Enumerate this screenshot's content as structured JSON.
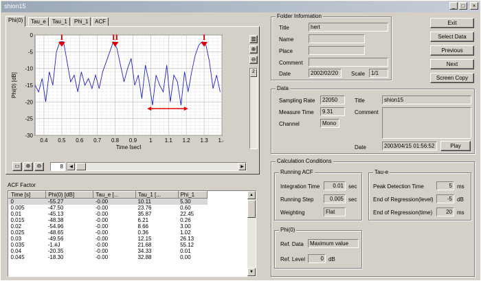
{
  "window": {
    "title": "shion15"
  },
  "tabs": [
    "Phi(0)",
    "Tau_e",
    "Tau_1",
    "Phi_1",
    "ACF"
  ],
  "chart_data": {
    "type": "line",
    "xlabel": "Time [sec]",
    "ylabel": "Phi(0) [dB]",
    "xlim": [
      0.35,
      1.4
    ],
    "ylim": [
      -30,
      0
    ],
    "xticks": [
      "0.4",
      "0.5",
      "0.6",
      "0.7",
      "0.8",
      "0.9",
      "1",
      "1.1",
      "1.2",
      "1.3",
      "1.4"
    ],
    "yticks": [
      "0",
      "-5",
      "-10",
      "-15",
      "-20",
      "-25",
      "-30"
    ],
    "grid": true,
    "series": [
      {
        "x": [
          0.35,
          0.37,
          0.39,
          0.41,
          0.43,
          0.45,
          0.47,
          0.49,
          0.51,
          0.53,
          0.55,
          0.57,
          0.59,
          0.61,
          0.63,
          0.65,
          0.67,
          0.69,
          0.71,
          0.73,
          0.75,
          0.77,
          0.79,
          0.81,
          0.83,
          0.85,
          0.87,
          0.89,
          0.91,
          0.93,
          0.95,
          0.97,
          0.99,
          1.01,
          1.03,
          1.05,
          1.07,
          1.09,
          1.11,
          1.13,
          1.15,
          1.17,
          1.19,
          1.21,
          1.23,
          1.25,
          1.27,
          1.29,
          1.31,
          1.33,
          1.35,
          1.37,
          1.39
        ],
        "y": [
          -15,
          -17,
          -13,
          -20,
          -11,
          -15,
          -5,
          -2,
          -2,
          -8,
          -14,
          -12,
          -17,
          -11,
          -15,
          -13,
          -16,
          -12,
          -16,
          -11,
          -8,
          -5,
          -2,
          -4,
          -9,
          -14,
          -10,
          -7,
          -15,
          -12,
          -19,
          -9,
          -14,
          -21,
          -12,
          -15,
          -17,
          -9,
          -20,
          -12,
          -14,
          -21,
          -11,
          -17,
          -11,
          -6,
          -3,
          -2,
          -3,
          -8,
          -16,
          -12,
          -17
        ]
      }
    ],
    "annotations": [
      {
        "text": "I",
        "x": 0.5
      },
      {
        "text": "II",
        "x": 0.8
      },
      {
        "text": "I",
        "x": 1.3
      }
    ]
  },
  "chart_toolbar": {
    "value": "8"
  },
  "acf": {
    "title": "ACF Factor",
    "columns": [
      "Time [s]",
      "Phi(0) [dB]",
      "Tau_e [...",
      "Tau_1 [...",
      "Phi_1"
    ],
    "rows": [
      [
        "0",
        "-55.27",
        "-0.00",
        "10.11",
        "5.30"
      ],
      [
        "0.005",
        "-47.50",
        "-0.00",
        "23.76",
        "0.60"
      ],
      [
        "0.01",
        "-45.13",
        "-0.00",
        "35.87",
        "22.45"
      ],
      [
        "0.015",
        "-48.38",
        "-0.00",
        "6.21",
        "0.26"
      ],
      [
        "0.02",
        "-54.96",
        "-0.00",
        "8.66",
        "3.00"
      ],
      [
        "0.025",
        "-48.65",
        "-0.00",
        "0.36",
        "1.02"
      ],
      [
        "0.03",
        "-49.56",
        "-0.00",
        "12.15",
        "26.13"
      ],
      [
        "0.035",
        "-1.#J",
        "-0.00",
        "21.68",
        "55.12"
      ],
      [
        "0.04",
        "-20.35",
        "-0.00",
        "34.33",
        "0.01"
      ],
      [
        "0.045",
        "-18.30",
        "-0.00",
        "32.88",
        "0.00"
      ]
    ]
  },
  "folder": {
    "title": "Folder Information",
    "title_label": "Title",
    "title_value": "hert",
    "name_label": "Name",
    "name_value": "",
    "place_label": "Place",
    "place_value": "",
    "comment_label": "Comment",
    "comment_value": "",
    "date_label": "Date",
    "date_value": "2002/02/20",
    "scale_label": "Scale",
    "scale_value": "1/1"
  },
  "buttons": {
    "exit": "Exit",
    "select_data": "Select Data",
    "previous": "Previous",
    "next": "Next",
    "screen_copy": "Screen Copy",
    "play": "Play"
  },
  "data": {
    "title": "Data",
    "sampling_rate_label": "Sampling Rate",
    "sampling_rate": "22050",
    "measure_time_label": "Measure Time",
    "measure_time": "9.31",
    "channel_label": "Channel",
    "channel": "Mono",
    "title_label": "Title",
    "title_value": "shion15",
    "comment_label": "Comment",
    "comment_value": "",
    "date_label": "Date",
    "date_value": "2003/04/15 01:56:52"
  },
  "calc": {
    "title": "Calculation Conditions",
    "running_acf": {
      "title": "Running ACF",
      "integration_time_label": "Integration Time",
      "integration_time": "0.01",
      "integration_unit": "sec",
      "running_step_label": "Running Step",
      "running_step": "0.005",
      "running_unit": "sec",
      "weighting_label": "Weighting",
      "weighting": "Flat"
    },
    "tau_e": {
      "title": "Tau-e",
      "peak_label": "Peak Detection Time",
      "peak": "5",
      "peak_unit": "ms",
      "end_level_label": "End of Regression(level)",
      "end_level": "-5",
      "end_level_unit": "dB",
      "end_time_label": "End of Regression(time)",
      "end_time": "20",
      "end_time_unit": "ms"
    },
    "phi0": {
      "title": "Phi(0)",
      "ref_data_label": "Ref. Data",
      "ref_data": "Maximum value",
      "ref_level_label": "Ref. Level",
      "ref_level": "0",
      "ref_level_unit": "dB"
    }
  }
}
